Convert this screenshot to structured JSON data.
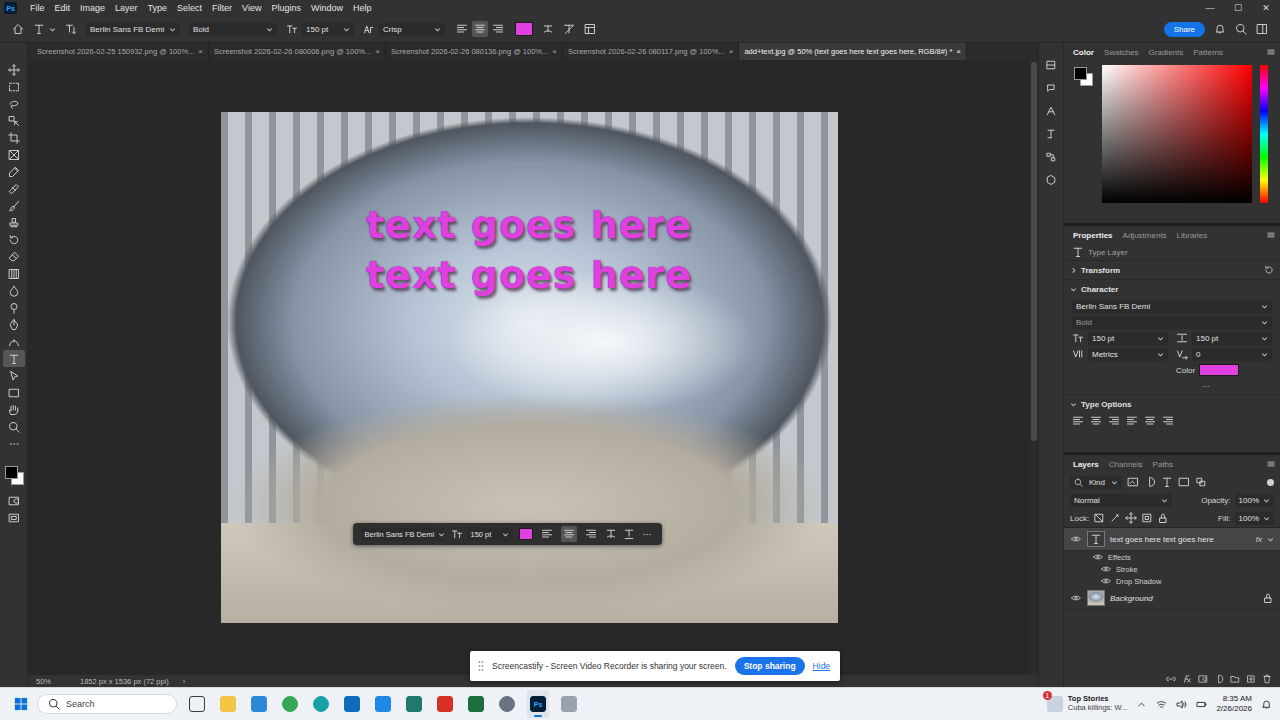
{
  "app": {
    "logo": "Ps",
    "menu": [
      "File",
      "Edit",
      "Image",
      "Layer",
      "Type",
      "Select",
      "Filter",
      "View",
      "Plugins",
      "Window",
      "Help"
    ],
    "window_controls": [
      "—",
      "☐",
      "✕"
    ]
  },
  "options_bar": {
    "font": "Berlin Sans FB Demi",
    "style": "Bold",
    "size": "150 pt",
    "antialias": "Crisp",
    "align": [
      {
        "selected": false
      },
      {
        "selected": true
      },
      {
        "selected": false
      }
    ],
    "text_color": "#e040e0",
    "share": "Share"
  },
  "colors": {
    "foreground": "#000000",
    "background": "#ffffff"
  },
  "tools": [
    {
      "kind": "move",
      "selected": false
    },
    {
      "kind": "marquee",
      "selected": false
    },
    {
      "kind": "lasso",
      "selected": false
    },
    {
      "kind": "objectselect",
      "selected": false
    },
    {
      "kind": "crop",
      "selected": false
    },
    {
      "kind": "frame",
      "selected": false
    },
    {
      "kind": "eyedropper",
      "selected": false
    },
    {
      "kind": "heal",
      "selected": false
    },
    {
      "kind": "brush",
      "selected": false
    },
    {
      "kind": "stamp",
      "selected": false
    },
    {
      "kind": "history",
      "selected": false
    },
    {
      "kind": "eraser",
      "selected": false
    },
    {
      "kind": "gradient",
      "selected": false
    },
    {
      "kind": "blur",
      "selected": false
    },
    {
      "kind": "dodge",
      "selected": false
    },
    {
      "kind": "pen",
      "selected": false
    },
    {
      "kind": "curvature",
      "selected": false
    },
    {
      "kind": "type",
      "selected": true
    },
    {
      "kind": "pathselect",
      "selected": false
    },
    {
      "kind": "rectangle",
      "selected": false
    },
    {
      "kind": "hand",
      "selected": false
    },
    {
      "kind": "zoom",
      "selected": false
    },
    {
      "kind": "more",
      "selected": false
    }
  ],
  "doc_tabs": [
    {
      "label": "Screenshot 2026-02-25 150932.png @ 100%...",
      "selected": false
    },
    {
      "label": "Screenshot 2026-02-26 080006.png @ 100%...",
      "selected": false
    },
    {
      "label": "Screenshot 2026-02-26 080136.png @ 100%...",
      "selected": false
    },
    {
      "label": "Screenshot 2026-02-26 080117.png @ 100%...",
      "selected": false
    },
    {
      "label": "add+text.jpg @ 50% (text goes here text goes here, RGB/8#) *",
      "selected": true
    }
  ],
  "tab_close": "×",
  "canvas": {
    "text_lines": [
      "text goes here",
      "text goes here"
    ]
  },
  "context_bar": {
    "font": "Berlin Sans FB Demi",
    "size": "150 pt",
    "align": [
      {
        "selected": false
      },
      {
        "selected": true
      },
      {
        "selected": false
      }
    ],
    "more": "···"
  },
  "status_bar": {
    "zoom": "50%",
    "doc_info": "1852 px x 1536 px (72 ppi)",
    "more": "›"
  },
  "color_panel": {
    "tabs": [
      {
        "label": "Color",
        "selected": true
      },
      {
        "label": "Swatches",
        "selected": false
      },
      {
        "label": "Gradients",
        "selected": false
      },
      {
        "label": "Patterns",
        "selected": false
      }
    ]
  },
  "properties": {
    "tabs": [
      {
        "label": "Properties",
        "selected": true
      },
      {
        "label": "Adjustments",
        "selected": false
      },
      {
        "label": "Libraries",
        "selected": false
      }
    ],
    "layer_kind": "Type Layer",
    "sections": [
      {
        "label": "Transform",
        "kind": "transform",
        "expanded": false
      },
      {
        "label": "Character",
        "kind": "character",
        "expanded": true
      },
      {
        "label": "Type Options",
        "kind": "type-options",
        "expanded": true
      }
    ],
    "font": "Berlin Sans FB Demi",
    "style": "Bold",
    "size": "150 pt",
    "leading": "150 pt",
    "kerning": "Metrics",
    "tracking": "0",
    "color_label": "Color",
    "more": "···"
  },
  "layers": {
    "tabs": [
      {
        "label": "Layers",
        "selected": true
      },
      {
        "label": "Channels",
        "selected": false
      },
      {
        "label": "Paths",
        "selected": false
      }
    ],
    "filter": "Kind",
    "blend": "Normal",
    "opacity_label": "Opacity:",
    "opacity": "100%",
    "lock_label": "Lock:",
    "fill_label": "Fill:",
    "fill": "100%",
    "items": [
      {
        "name": "text goes here text goes here",
        "kind": "text",
        "visible": true,
        "selected": true,
        "locked": false,
        "fx": "fx",
        "effects_label": "Effects",
        "effects": [
          {
            "name": "Stroke",
            "visible": true
          },
          {
            "name": "Drop Shadow",
            "visible": true
          }
        ]
      },
      {
        "name": "Background",
        "kind": "image",
        "visible": true,
        "selected": false,
        "locked": true,
        "fx": "",
        "effects_label": "",
        "effects": []
      }
    ]
  },
  "banner": {
    "message": "Screencastify - Screen Video Recorder is sharing your screen.",
    "stop": "Stop sharing",
    "hide": "Hide"
  },
  "taskbar": {
    "search": "Search",
    "apps": [
      {
        "kind": "outline",
        "color": "#3c3c3c",
        "label": "",
        "active": false
      },
      {
        "kind": "tile",
        "color": "#f4c542",
        "label": "",
        "active": false
      },
      {
        "kind": "tile",
        "color": "#2b88d8",
        "label": "",
        "active": false
      },
      {
        "kind": "circle",
        "color": "#34a853",
        "label": "",
        "active": false
      },
      {
        "kind": "circle",
        "color": "#1ba0a8",
        "label": "",
        "active": false
      },
      {
        "kind": "tile",
        "color": "#0f6cbd",
        "label": "",
        "active": false
      },
      {
        "kind": "tile",
        "color": "#1e88e5",
        "label": "",
        "active": false
      },
      {
        "kind": "tile",
        "color": "#1f7a6b",
        "label": "",
        "active": false
      },
      {
        "kind": "tile",
        "color": "#d93025",
        "label": "",
        "active": false
      },
      {
        "kind": "tile",
        "color": "#1d6f42",
        "label": "",
        "active": false
      },
      {
        "kind": "circle",
        "color": "#6b7280",
        "label": "",
        "active": false
      },
      {
        "kind": "tile",
        "color": "#001e36",
        "label": "Ps",
        "active": true
      },
      {
        "kind": "tile",
        "color": "#9aa3ad",
        "label": "",
        "active": false
      }
    ],
    "news_title": "Top Stories",
    "news_text": "Cuba killings: W...",
    "news_badge": "1",
    "time": "8:35 AM",
    "date": "2/26/2026"
  }
}
